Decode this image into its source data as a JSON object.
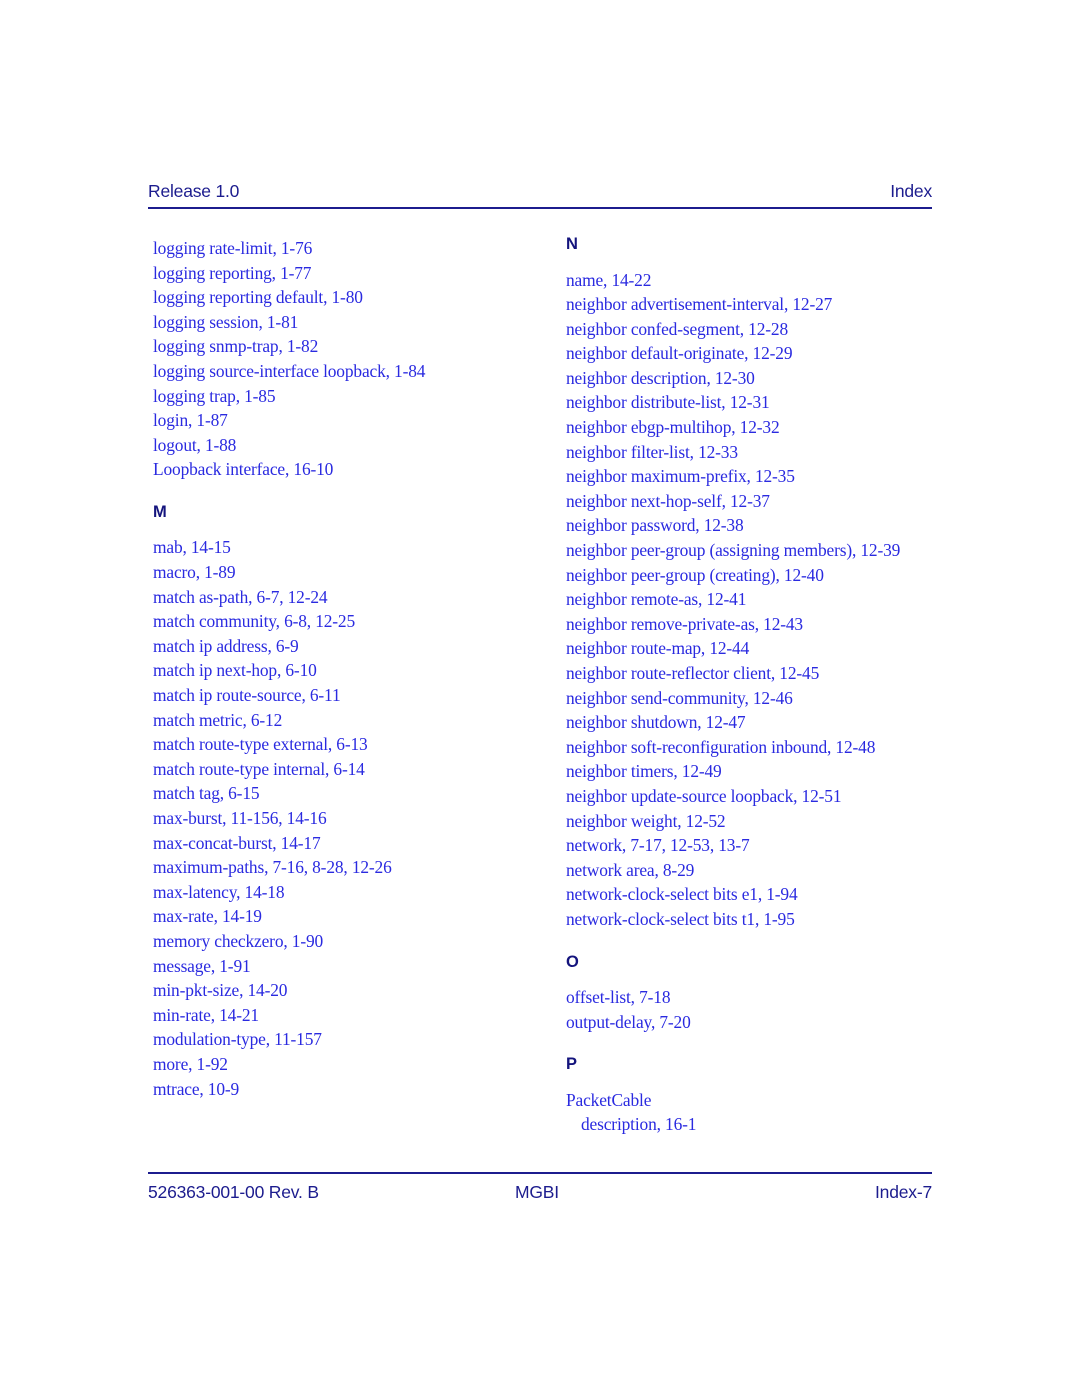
{
  "header": {
    "left": "Release 1.0",
    "right": "Index"
  },
  "footer": {
    "left": "526363-001-00 Rev. B",
    "center": "MGBI",
    "right": "Index-7"
  },
  "colors": {
    "heading": "#14147d",
    "entry": "#2a2ae0",
    "rule": "#1c1c8e",
    "page_background": "#ffffff"
  },
  "columns": {
    "left": {
      "blocks": [
        {
          "heading": null,
          "entries": [
            {
              "text": "logging rate-limit, 1-76",
              "sub": false
            },
            {
              "text": "logging reporting, 1-77",
              "sub": false
            },
            {
              "text": "logging reporting default, 1-80",
              "sub": false
            },
            {
              "text": "logging session, 1-81",
              "sub": false
            },
            {
              "text": "logging snmp-trap, 1-82",
              "sub": false
            },
            {
              "text": "logging source-interface loopback, 1-84",
              "sub": false
            },
            {
              "text": "logging trap, 1-85",
              "sub": false
            },
            {
              "text": "login, 1-87",
              "sub": false
            },
            {
              "text": "logout, 1-88",
              "sub": false
            },
            {
              "text": "Loopback interface, 16-10",
              "sub": false
            }
          ]
        },
        {
          "heading": "M",
          "entries": [
            {
              "text": "mab, 14-15",
              "sub": false
            },
            {
              "text": "macro, 1-89",
              "sub": false
            },
            {
              "text": "match as-path, 6-7, 12-24",
              "sub": false
            },
            {
              "text": "match community, 6-8, 12-25",
              "sub": false
            },
            {
              "text": "match ip address, 6-9",
              "sub": false
            },
            {
              "text": "match ip next-hop, 6-10",
              "sub": false
            },
            {
              "text": "match ip route-source, 6-11",
              "sub": false
            },
            {
              "text": "match metric, 6-12",
              "sub": false
            },
            {
              "text": "match route-type external, 6-13",
              "sub": false
            },
            {
              "text": "match route-type internal, 6-14",
              "sub": false
            },
            {
              "text": "match tag, 6-15",
              "sub": false
            },
            {
              "text": "max-burst, 11-156, 14-16",
              "sub": false
            },
            {
              "text": "max-concat-burst, 14-17",
              "sub": false
            },
            {
              "text": "maximum-paths, 7-16, 8-28, 12-26",
              "sub": false
            },
            {
              "text": "max-latency, 14-18",
              "sub": false
            },
            {
              "text": "max-rate, 14-19",
              "sub": false
            },
            {
              "text": "memory checkzero, 1-90",
              "sub": false
            },
            {
              "text": "message, 1-91",
              "sub": false
            },
            {
              "text": "min-pkt-size, 14-20",
              "sub": false
            },
            {
              "text": "min-rate, 14-21",
              "sub": false
            },
            {
              "text": "modulation-type, 11-157",
              "sub": false
            },
            {
              "text": "more, 1-92",
              "sub": false
            },
            {
              "text": "mtrace, 10-9",
              "sub": false
            }
          ]
        }
      ]
    },
    "right": {
      "blocks": [
        {
          "heading": "N",
          "entries": [
            {
              "text": "name, 14-22",
              "sub": false
            },
            {
              "text": "neighbor advertisement-interval, 12-27",
              "sub": false
            },
            {
              "text": "neighbor confed-segment, 12-28",
              "sub": false
            },
            {
              "text": "neighbor default-originate, 12-29",
              "sub": false
            },
            {
              "text": "neighbor description, 12-30",
              "sub": false
            },
            {
              "text": "neighbor distribute-list, 12-31",
              "sub": false
            },
            {
              "text": "neighbor ebgp-multihop, 12-32",
              "sub": false
            },
            {
              "text": "neighbor filter-list, 12-33",
              "sub": false
            },
            {
              "text": "neighbor maximum-prefix, 12-35",
              "sub": false
            },
            {
              "text": "neighbor next-hop-self, 12-37",
              "sub": false
            },
            {
              "text": "neighbor password, 12-38",
              "sub": false
            },
            {
              "text": "neighbor peer-group (assigning members), 12-39",
              "sub": false
            },
            {
              "text": "neighbor peer-group (creating), 12-40",
              "sub": false
            },
            {
              "text": "neighbor remote-as, 12-41",
              "sub": false
            },
            {
              "text": "neighbor remove-private-as, 12-43",
              "sub": false
            },
            {
              "text": "neighbor route-map, 12-44",
              "sub": false
            },
            {
              "text": "neighbor route-reflector client, 12-45",
              "sub": false
            },
            {
              "text": "neighbor send-community, 12-46",
              "sub": false
            },
            {
              "text": "neighbor shutdown, 12-47",
              "sub": false
            },
            {
              "text": "neighbor soft-reconfiguration inbound, 12-48",
              "sub": false
            },
            {
              "text": "neighbor timers, 12-49",
              "sub": false
            },
            {
              "text": "neighbor update-source loopback, 12-51",
              "sub": false
            },
            {
              "text": "neighbor weight, 12-52",
              "sub": false
            },
            {
              "text": "network, 7-17, 12-53, 13-7",
              "sub": false
            },
            {
              "text": "network area, 8-29",
              "sub": false
            },
            {
              "text": "network-clock-select bits e1, 1-94",
              "sub": false
            },
            {
              "text": "network-clock-select bits t1, 1-95",
              "sub": false
            }
          ]
        },
        {
          "heading": "O",
          "entries": [
            {
              "text": "offset-list, 7-18",
              "sub": false
            },
            {
              "text": "output-delay, 7-20",
              "sub": false
            }
          ]
        },
        {
          "heading": "P",
          "entries": [
            {
              "text": "PacketCable",
              "sub": false
            },
            {
              "text": "description, 16-1",
              "sub": true
            }
          ]
        }
      ]
    }
  }
}
